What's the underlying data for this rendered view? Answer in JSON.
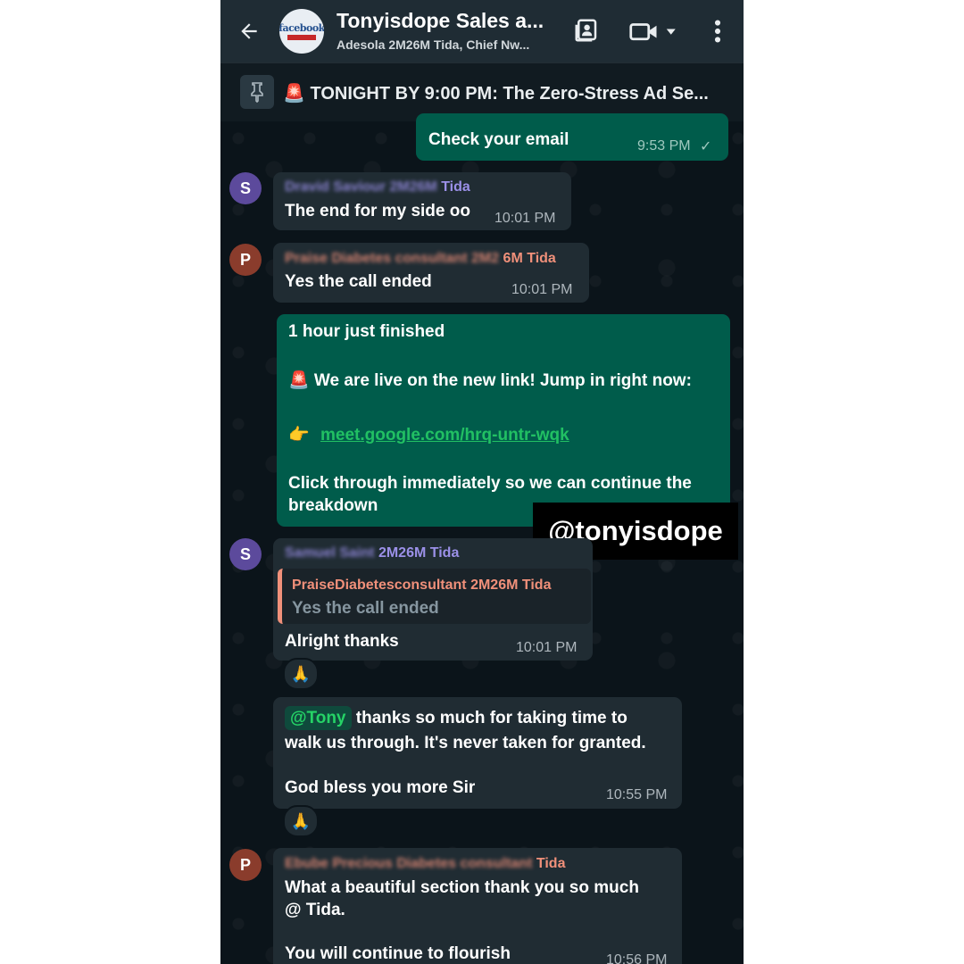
{
  "header": {
    "title": "Tonyisdope Sales a...",
    "members": "Adesola 2M26M Tida, Chief Nw...",
    "avatar_text": "facebook"
  },
  "pinned": {
    "text": "🚨 TONIGHT BY 9:00 PM: The Zero-Stress Ad Se..."
  },
  "messages": [
    {
      "id": "m1",
      "direction": "out",
      "text": "Check your email",
      "time": "9:53 PM",
      "status": "✓"
    },
    {
      "id": "m2",
      "direction": "in",
      "avatar": "S",
      "sender": "Tida",
      "sender_blurred": "Dravid Saviour 2M26M",
      "text": "The end for my side oo",
      "time": "10:01 PM"
    },
    {
      "id": "m3",
      "direction": "in",
      "avatar": "P",
      "sender": "6M Tida",
      "sender_blurred": "Praise Diabetes consultant 2M2",
      "text": "Yes the call ended",
      "time": "10:01 PM"
    },
    {
      "id": "m4",
      "direction": "out",
      "line1": "1 hour just finished",
      "line2": "🚨 We are live on the new link! Jump in right now:",
      "pointer": "👉",
      "link": "meet.google.com/hrq-untr-wqk",
      "line3": "Click through immediately so we can continue the",
      "line4": "breakdown"
    },
    {
      "id": "m5",
      "direction": "in",
      "avatar": "S",
      "sender": "2M26M Tida",
      "sender_blurred": "Samuel Saint",
      "quote_sender": "PraiseDiabetesconsultant 2M26M Tida",
      "quote_text": "Yes the call ended",
      "text": "Alright thanks",
      "time": "10:01 PM",
      "reaction": "🙏"
    },
    {
      "id": "m6",
      "direction": "in",
      "mention": "@Tony",
      "line1": " thanks so much for taking time to",
      "line2": "walk us through. It's never taken for granted.",
      "line3": "God bless you more Sir",
      "time": "10:55 PM",
      "reaction": "🙏"
    },
    {
      "id": "m7",
      "direction": "in",
      "avatar": "P",
      "sender": "Tida",
      "sender_blurred": "Ebube Precious Diabetes consultant",
      "line1": "What a beautiful section thank you so much",
      "line2": "@ Tida.",
      "line3": "You will continue to flourish",
      "time": "10:56 PM"
    }
  ],
  "watermark": "@tonyisdope",
  "colors": {
    "outgoing_bubble": "#005c4b",
    "incoming_bubble": "#202c33",
    "background": "#0b141a",
    "header": "#1f2c34"
  }
}
